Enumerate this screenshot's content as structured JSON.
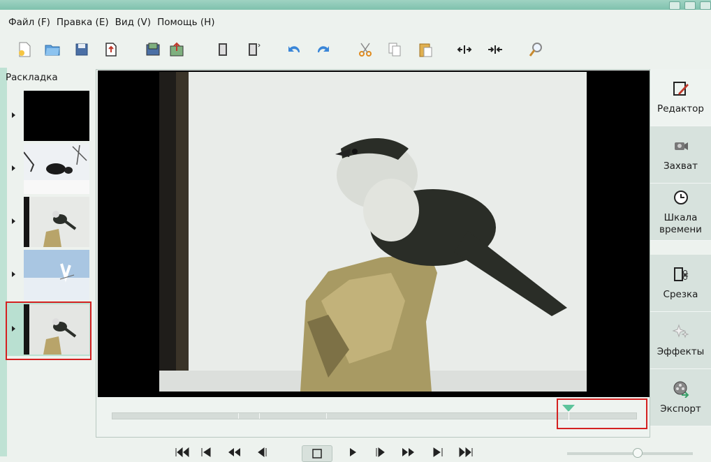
{
  "menu": [
    {
      "label": "Файл (F)"
    },
    {
      "label": "Правка (E)"
    },
    {
      "label": "Вид (V)"
    },
    {
      "label": "Помощь (H)"
    }
  ],
  "toolbar_icons": [
    "new-document-icon",
    "open-folder-icon",
    "save-icon",
    "export-icon",
    "save-frame-icon",
    "export-image-icon",
    "split-scene-icon",
    "join-scene-icon",
    "undo-icon",
    "redo-icon",
    "cut-icon",
    "copy-icon",
    "paste-icon",
    "expand-icon",
    "contract-icon",
    "zoom-icon"
  ],
  "storyboard": {
    "label": "Раскладка",
    "clips": [
      "black-clip",
      "wolverine-in-snow-clip",
      "bird-on-stump-clip",
      "skier-jump-clip",
      "bird-on-stump-selected-clip"
    ],
    "selected_index": 4
  },
  "modes": [
    {
      "label": "Редактор",
      "icon": "editor-icon"
    },
    {
      "label": "Захват",
      "icon": "camera-icon"
    },
    {
      "label": "Шкала\nвремени",
      "icon": "clock-icon"
    },
    {
      "label": "Срезка",
      "icon": "trim-scissors-icon"
    },
    {
      "label": "Эффекты",
      "icon": "effects-sparkle-icon"
    },
    {
      "label": "Экспорт",
      "icon": "export-reel-icon"
    }
  ],
  "playhead_position": 0.87,
  "colors": {
    "accent": "#5cc49c",
    "highlight": "#d42020"
  }
}
